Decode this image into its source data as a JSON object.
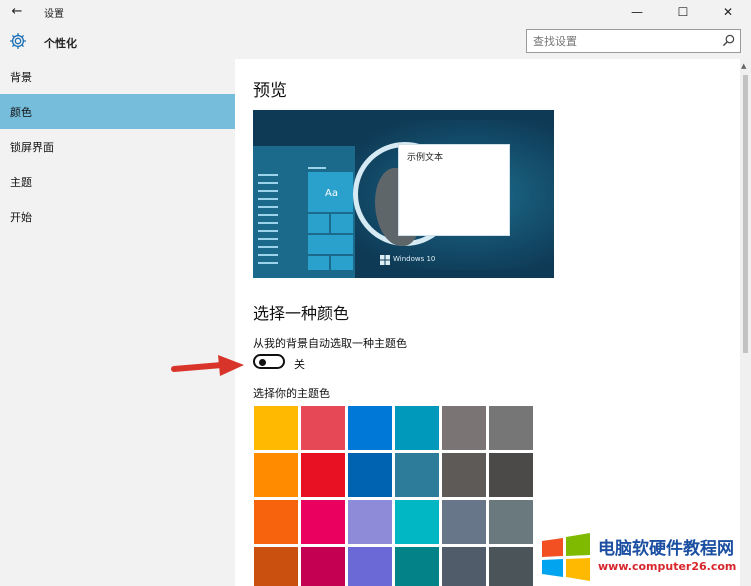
{
  "window": {
    "title": "设置",
    "back_glyph": "←",
    "minimize_glyph": "—",
    "maximize_glyph": "☐",
    "close_glyph": "✕"
  },
  "header": {
    "section_title": "个性化",
    "search_placeholder": "查找设置"
  },
  "sidebar": {
    "items": [
      {
        "label": "背景",
        "active": false
      },
      {
        "label": "颜色",
        "active": true
      },
      {
        "label": "锁屏界面",
        "active": false
      },
      {
        "label": "主题",
        "active": false
      },
      {
        "label": "开始",
        "active": false
      }
    ]
  },
  "main": {
    "preview_heading": "预览",
    "preview": {
      "tile_text": "Aa",
      "sample_text": "示例文本",
      "windows_label": "Windows 10"
    },
    "choose_heading": "选择一种颜色",
    "auto_pick_label": "从我的背景自动选取一种主题色",
    "toggle_state_label": "关",
    "toggle_on": false,
    "pick_label": "选择你的主题色"
  },
  "swatches": [
    [
      "#ffb900",
      "#e74856",
      "#0078d7",
      "#0099bc",
      "#7a7574",
      "#767676"
    ],
    [
      "#ff8c00",
      "#e81123",
      "#0063b1",
      "#2d7d9a",
      "#5d5a58",
      "#4c4a48"
    ],
    [
      "#f7630c",
      "#ea005e",
      "#8e8cd8",
      "#00b7c3",
      "#68768a",
      "#69797e"
    ],
    [
      "#ca5010",
      "#c30052",
      "#6b69d6",
      "#038387",
      "#515c6b",
      "#4a5459"
    ]
  ],
  "accent_color": "#76bddc",
  "watermark": {
    "title": "电脑软硬件教程网",
    "url": "www.computer26.com"
  }
}
